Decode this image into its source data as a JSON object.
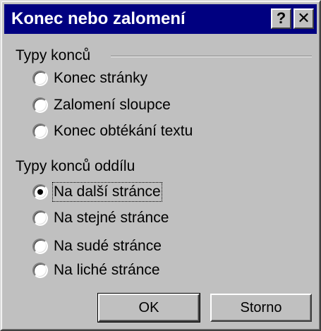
{
  "window": {
    "title": "Konec nebo zalomení",
    "help_button": "?",
    "close_button": "✕"
  },
  "break_types": {
    "label": "Typy konců",
    "options": [
      {
        "label": "Konec stránky",
        "selected": false
      },
      {
        "label": "Zalomení sloupce",
        "selected": false
      },
      {
        "label": "Konec obtékání textu",
        "selected": false
      }
    ]
  },
  "section_break_types": {
    "label": "Typy konců oddílu",
    "options": [
      {
        "label": "Na další stránce",
        "selected": true
      },
      {
        "label": "Na stejné stránce",
        "selected": false
      },
      {
        "label": "Na sudé stránce",
        "selected": false
      },
      {
        "label": "Na liché stránce",
        "selected": false
      }
    ]
  },
  "buttons": {
    "ok": "OK",
    "cancel": "Storno"
  }
}
